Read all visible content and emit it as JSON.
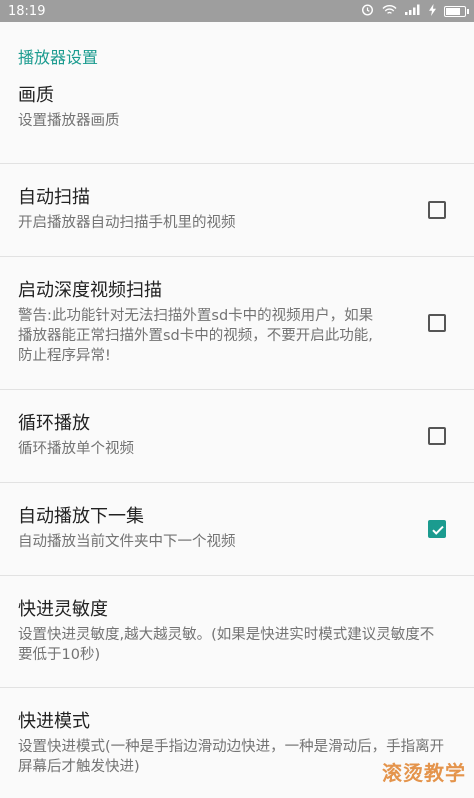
{
  "status_bar": {
    "time": "18:19",
    "icons": [
      "alarm-icon",
      "wifi-icon",
      "signal-icon",
      "charging-icon",
      "battery-icon"
    ]
  },
  "section_title": "播放器设置",
  "items": [
    {
      "title": "画质",
      "summary": "设置播放器画质",
      "has_checkbox": false
    },
    {
      "title": "自动扫描",
      "summary": "开启播放器自动扫描手机里的视频",
      "has_checkbox": true,
      "checked": false
    },
    {
      "title": "启动深度视频扫描",
      "summary": "警告:此功能针对无法扫描外置sd卡中的视频用户，如果播放器能正常扫描外置sd卡中的视频，不要开启此功能,防止程序异常!",
      "has_checkbox": true,
      "checked": false
    },
    {
      "title": "循环播放",
      "summary": "循环播放单个视频",
      "has_checkbox": true,
      "checked": false
    },
    {
      "title": "自动播放下一集",
      "summary": "自动播放当前文件夹中下一个视频",
      "has_checkbox": true,
      "checked": true
    },
    {
      "title": "快进灵敏度",
      "summary": "设置快进灵敏度,越大越灵敏。(如果是快进实时模式建议灵敏度不要低于10秒)",
      "has_checkbox": false
    },
    {
      "title": "快进模式",
      "summary": "设置快进模式(一种是手指边滑动边快进，一种是滑动后，手指离开屏幕后才触发快进)",
      "has_checkbox": false
    }
  ],
  "watermark": "滚烫教学",
  "colors": {
    "accent": "#1b9b8f",
    "status_bar": "#9e9e9e"
  }
}
